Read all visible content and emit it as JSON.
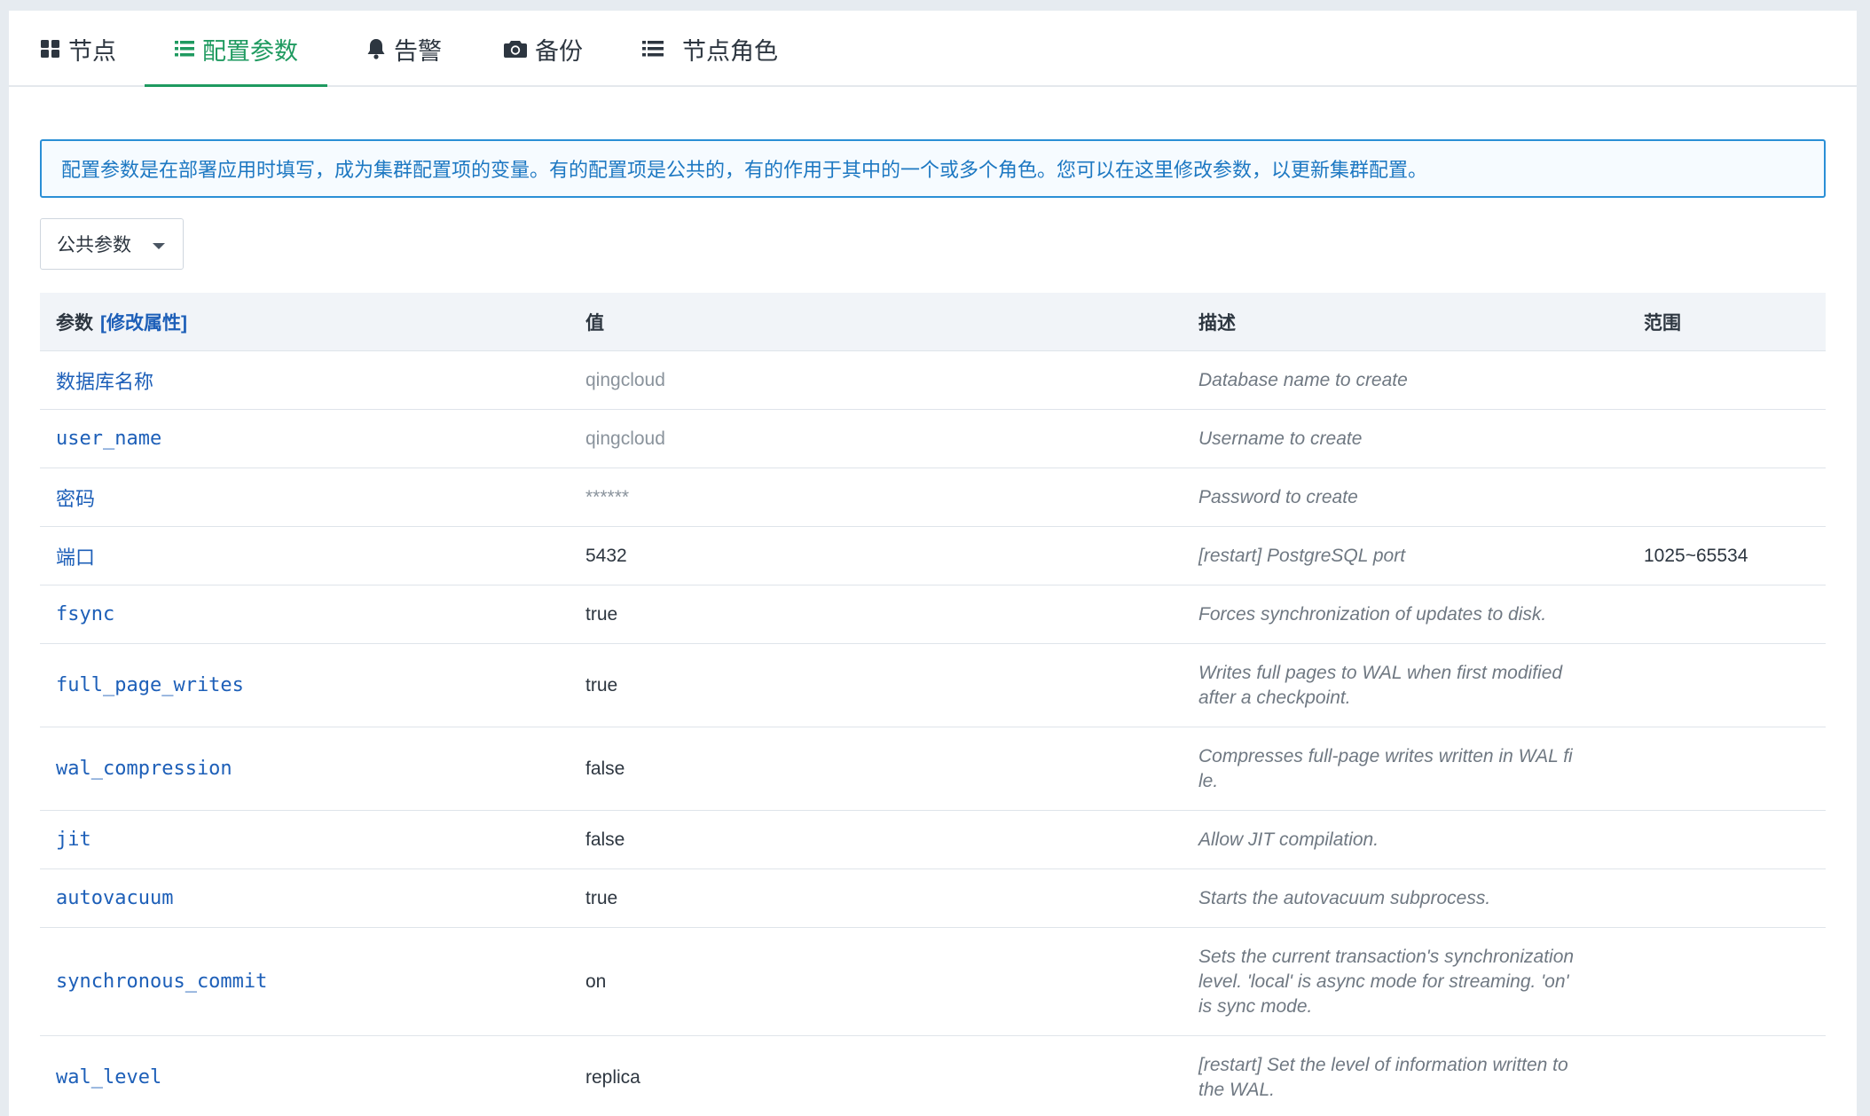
{
  "tabs": [
    {
      "label": "节点",
      "icon": "grid-icon",
      "active": false
    },
    {
      "label": "配置参数",
      "icon": "list-icon",
      "active": true
    },
    {
      "label": "告警",
      "icon": "bell-icon",
      "active": false
    },
    {
      "label": "备份",
      "icon": "camera-icon",
      "active": false
    },
    {
      "label": "节点角色",
      "icon": "list-icon",
      "active": false
    }
  ],
  "accent_color": "#1f9a60",
  "link_color": "#1d5fb8",
  "notice": {
    "text": "配置参数是在部署应用时填写，成为集群配置项的变量。有的配置项是公共的，有的作用于其中的一个或多个角色。您可以在这里修改参数，以更新集群配置。",
    "color": "#2a8fd6"
  },
  "dropdown": {
    "selected": "公共参数"
  },
  "table": {
    "headers": {
      "param": "参数",
      "edit_link": "[修改属性]",
      "value": "值",
      "desc": "描述",
      "range": "范围"
    },
    "rows": [
      {
        "param": "数据库名称",
        "value": "qingcloud",
        "desc": "Database name to create",
        "range": ""
      },
      {
        "param": "user_name",
        "value": "qingcloud",
        "desc": "Username to create",
        "range": ""
      },
      {
        "param": "密码",
        "value": "******",
        "desc": "Password to create",
        "range": ""
      },
      {
        "param": "端口",
        "value": "5432",
        "desc": "[restart] PostgreSQL port",
        "range": "1025~65534"
      },
      {
        "param": "fsync",
        "value": "true",
        "desc": "Forces synchronization of updates to disk.",
        "range": ""
      },
      {
        "param": "full_page_writes",
        "value": "true",
        "desc": "Writes full pages to WAL when first modified\nafter a checkpoint.",
        "range": ""
      },
      {
        "param": "wal_compression",
        "value": "false",
        "desc": "Compresses full-page writes written in WAL fi\nle.",
        "range": ""
      },
      {
        "param": "jit",
        "value": "false",
        "desc": "Allow JIT compilation.",
        "range": ""
      },
      {
        "param": "autovacuum",
        "value": "true",
        "desc": "Starts the autovacuum subprocess.",
        "range": ""
      },
      {
        "param": "synchronous_commit",
        "value": "on",
        "desc": "Sets the current transaction's synchronization\nlevel. 'local' is async mode for streaming. 'on'\nis sync mode.",
        "range": ""
      },
      {
        "param": "wal_level",
        "value": "replica",
        "desc": "[restart] Set the level of information written to\nthe WAL.",
        "range": ""
      }
    ]
  }
}
